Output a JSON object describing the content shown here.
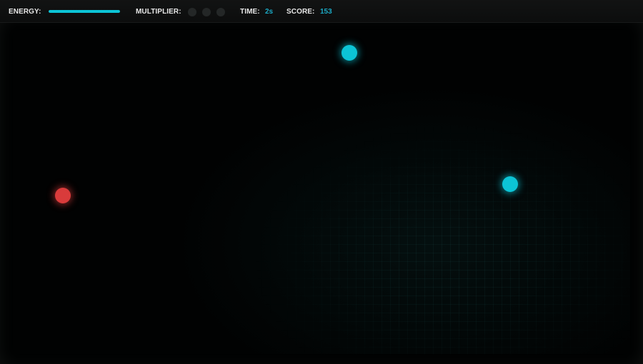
{
  "hud": {
    "energy_label": "ENERGY:",
    "energy_level": 1.0,
    "multiplier_label": "MULTIPLIER:",
    "multiplier_active": 0,
    "multiplier_max": 3,
    "time_label": "TIME:",
    "time_value": "2s",
    "score_label": "SCORE:",
    "score_value": "153"
  },
  "field": {
    "orbs": [
      {
        "kind": "enemy",
        "color": "#d93b3b"
      },
      {
        "kind": "energy",
        "color": "#0cc4d6"
      },
      {
        "kind": "energy",
        "color": "#0cc4d6"
      }
    ]
  },
  "colors": {
    "accent": "#0cc4d6",
    "value_text": "#1ba9c4",
    "hud_label": "#e8e8e8",
    "inactive_dot": "#242727",
    "enemy": "#d93b3b"
  }
}
